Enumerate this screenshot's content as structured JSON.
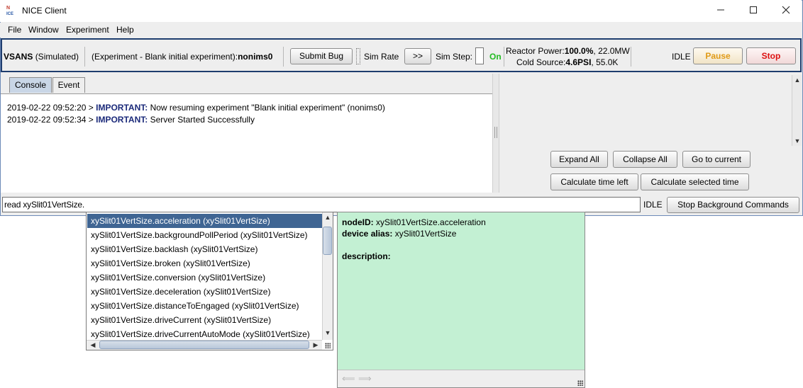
{
  "window": {
    "title": "NICE Client",
    "icon_text_top": "N",
    "icon_text_bottom": "ICE"
  },
  "menu": [
    "File",
    "Window",
    "Experiment",
    "Help"
  ],
  "toolbar": {
    "instrument": "VSANS",
    "instrument_mode": "(Simulated)",
    "experiment_prefix": "(Experiment - Blank initial experiment):",
    "experiment_id": "nonims0",
    "submit_bug": "Submit Bug",
    "sim_rate_label": "Sim Rate",
    "sim_rate_button": ">>",
    "sim_step_label": "Sim Step:",
    "sim_step_state": "On",
    "reactor_power_label": "Reactor Power:",
    "reactor_power_value": "100.0%",
    "reactor_power_extra": ", 22.0MW",
    "cold_source_label": "Cold Source:",
    "cold_source_value": "4.6PSI",
    "cold_source_extra": ", 55.0K",
    "status": "IDLE",
    "pause": "Pause",
    "stop": "Stop"
  },
  "tabs": [
    {
      "label": "Console",
      "active": true
    },
    {
      "label": "Event",
      "active": false
    }
  ],
  "console": [
    {
      "timestamp": "2019-02-22 09:52:20 >",
      "level": "IMPORTANT:",
      "message": "Now resuming experiment \"Blank initial experiment\" (nonims0)"
    },
    {
      "timestamp": "2019-02-22 09:52:34 >",
      "level": "IMPORTANT:",
      "message": "Server Started Successfully"
    }
  ],
  "tree_buttons": {
    "expand_all": "Expand All",
    "collapse_all": "Collapse All",
    "go_to_current": "Go to current",
    "calc_time_left": "Calculate time left",
    "calc_selected_time": "Calculate selected time"
  },
  "command": {
    "value": "read xySlit01VertSize.",
    "status": "IDLE",
    "stop_background": "Stop Background Commands"
  },
  "autocomplete": [
    "xySlit01VertSize.acceleration (xySlit01VertSize)",
    "xySlit01VertSize.backgroundPollPeriod (xySlit01VertSize)",
    "xySlit01VertSize.backlash (xySlit01VertSize)",
    "xySlit01VertSize.broken (xySlit01VertSize)",
    "xySlit01VertSize.conversion (xySlit01VertSize)",
    "xySlit01VertSize.deceleration (xySlit01VertSize)",
    "xySlit01VertSize.distanceToEngaged (xySlit01VertSize)",
    "xySlit01VertSize.driveCurrent (xySlit01VertSize)",
    "xySlit01VertSize.driveCurrentAutoMode (xySlit01VertSize)"
  ],
  "info": {
    "node_id_label": "nodeID:",
    "node_id_value": "xySlit01VertSize.acceleration",
    "alias_label": "device alias:",
    "alias_value": "xySlit01VertSize",
    "description_label": "description:"
  },
  "colors": {
    "accent_selection": "#3f6593",
    "info_background": "#c3f0d3",
    "sim_on": "#22bb22",
    "pause": "#e09a16",
    "stop": "#dd1111",
    "log_level": "#1b2a7a"
  },
  "icons": [
    "minimize-icon",
    "maximize-icon",
    "close-icon",
    "scroll-up-icon",
    "scroll-down-icon",
    "scroll-left-icon",
    "scroll-right-icon",
    "back-arrow-icon",
    "forward-arrow-icon",
    "resize-grip-icon"
  ]
}
